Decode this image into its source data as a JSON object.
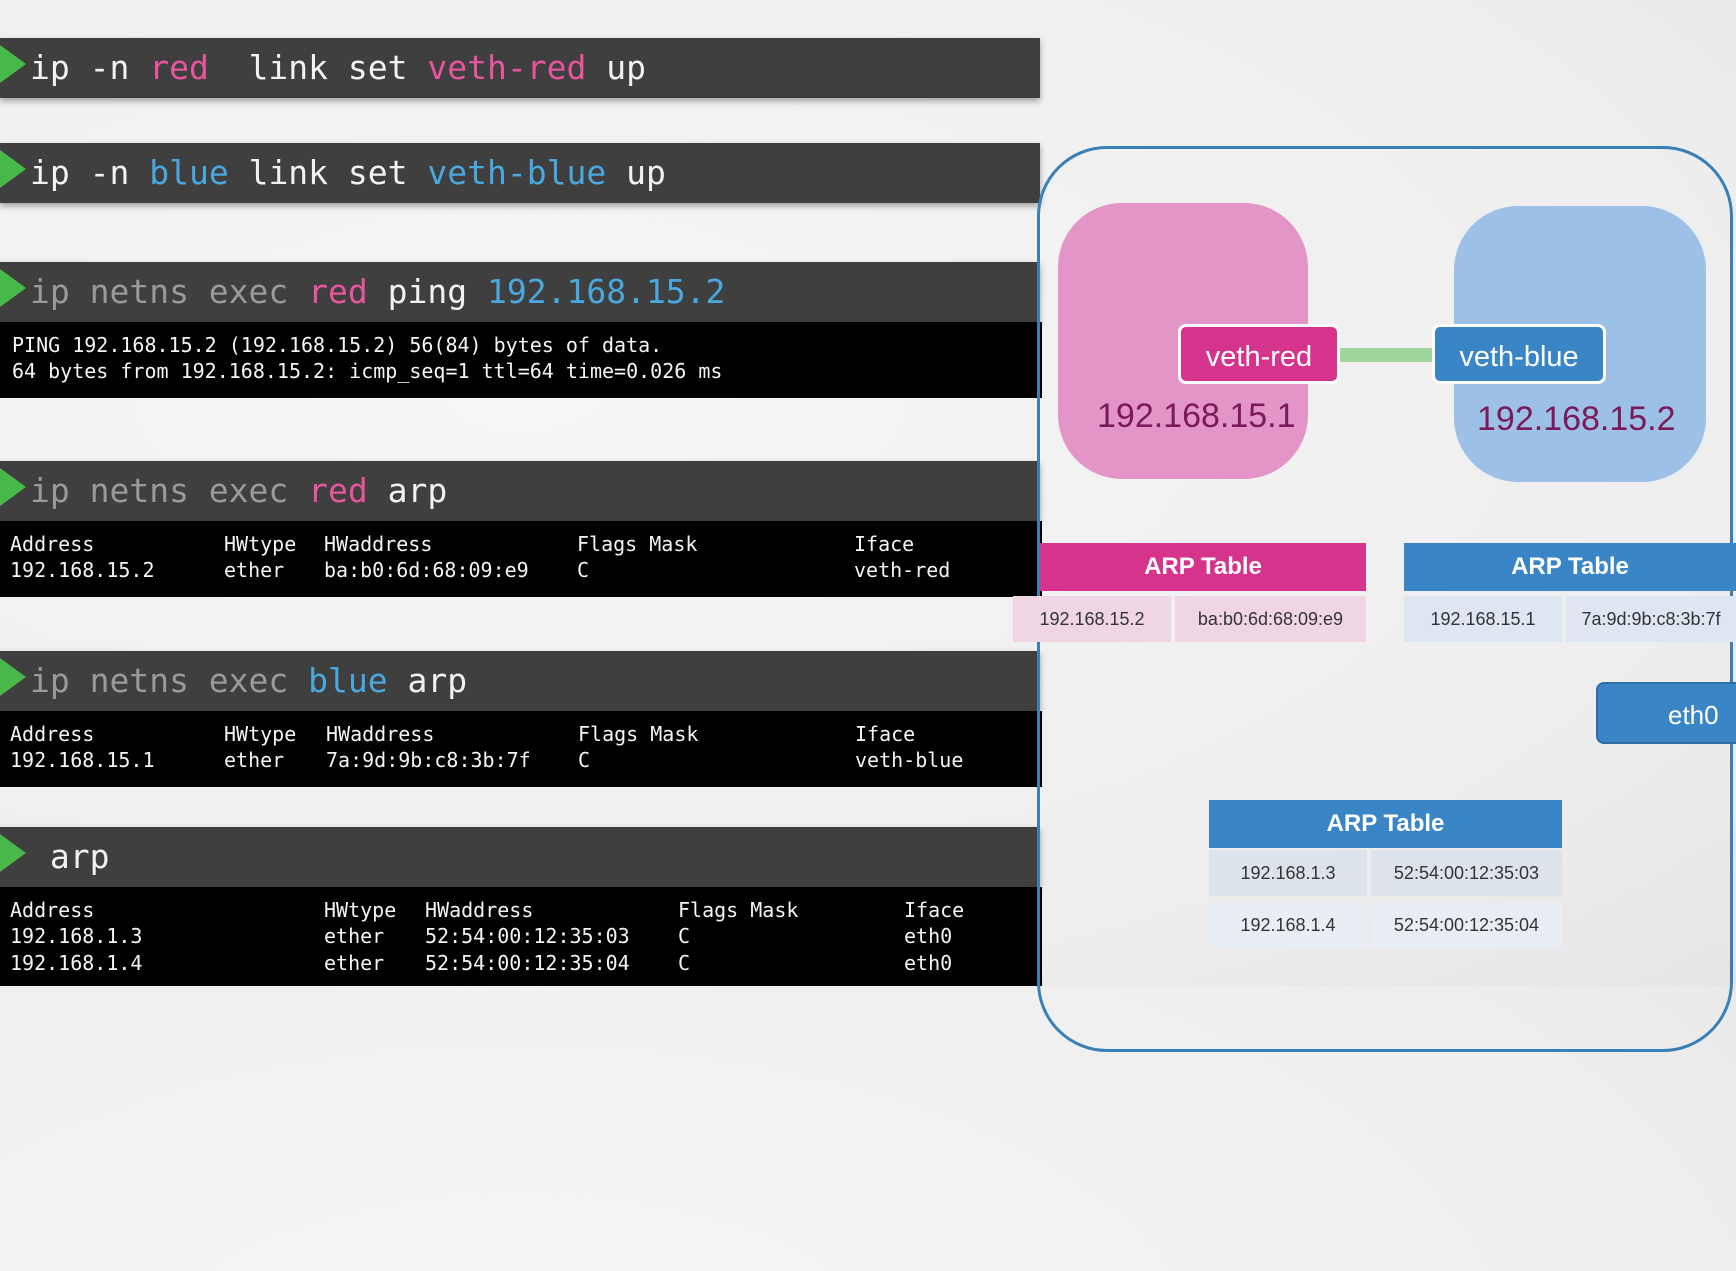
{
  "commands": {
    "red_link_up": {
      "p1": "ip -n ",
      "ns": "red",
      "p2": "  link set ",
      "iface": "veth-red",
      "p3": " up"
    },
    "blue_link_up": {
      "p1": "ip -n ",
      "ns": "blue",
      "p2": " link set ",
      "iface": "veth-blue",
      "p3": " up"
    },
    "ping": {
      "p1": "ip netns exec ",
      "ns": "red",
      "p2": " ping ",
      "target": "192.168.15.2"
    },
    "arp_red": {
      "p1": "ip netns exec ",
      "ns": "red",
      "p2": " arp"
    },
    "arp_blue": {
      "p1": "ip netns exec ",
      "ns": "blue",
      "p2": " arp"
    },
    "arp_host": {
      "text": " arp"
    }
  },
  "ping_output": [
    "PING 192.168.15.2 (192.168.15.2) 56(84) bytes of data.",
    "64 bytes from 192.168.15.2: icmp_seq=1 ttl=64 time=0.026 ms"
  ],
  "arp_red_output": {
    "headers": [
      "Address",
      "HWtype",
      "HWaddress",
      "Flags Mask",
      "Iface"
    ],
    "rows": [
      [
        "192.168.15.2",
        "ether",
        "ba:b0:6d:68:09:e9",
        "C",
        "veth-red"
      ]
    ]
  },
  "arp_blue_output": {
    "headers": [
      "Address",
      "HWtype",
      "HWaddress",
      "Flags Mask",
      "Iface"
    ],
    "rows": [
      [
        "192.168.15.1",
        "ether",
        "7a:9d:9b:c8:3b:7f",
        "C",
        "veth-blue"
      ]
    ]
  },
  "arp_host_output": {
    "headers": [
      "Address",
      "HWtype",
      "HWaddress",
      "Flags Mask",
      "Iface"
    ],
    "rows": [
      [
        "192.168.1.3",
        "ether",
        "52:54:00:12:35:03",
        "C",
        "eth0"
      ],
      [
        "192.168.1.4",
        "ether",
        "52:54:00:12:35:04",
        "C",
        "eth0"
      ]
    ]
  },
  "diagram": {
    "red_ns": {
      "iface": "veth-red",
      "ip": "192.168.15.1",
      "color": "#e395c7"
    },
    "blue_ns": {
      "iface": "veth-blue",
      "ip": "192.168.15.2",
      "color": "#9dc1e6"
    },
    "red_arp": {
      "title": "ARP Table",
      "rows": [
        [
          "192.168.15.2",
          "ba:b0:6d:68:09:e9"
        ]
      ]
    },
    "blue_arp": {
      "title": "ARP Table",
      "rows": [
        [
          "192.168.15.1",
          "7a:9d:9b:c8:3b:7f"
        ]
      ]
    },
    "host_arp": {
      "title": "ARP Table",
      "rows": [
        [
          "192.168.1.3",
          "52:54:00:12:35:03"
        ],
        [
          "192.168.1.4",
          "52:54:00:12:35:04"
        ]
      ]
    },
    "host_iface": "eth0"
  }
}
